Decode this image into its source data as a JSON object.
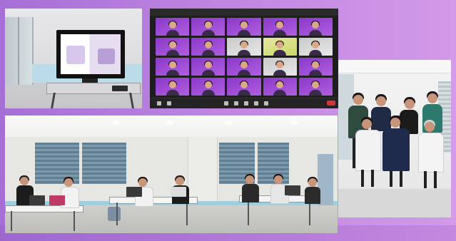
{
  "scene": {
    "photos": [
      {
        "id": "meeting-room-tv"
      },
      {
        "id": "video-call-gallery",
        "grid": {
          "rows": 4,
          "columns": 5
        }
      },
      {
        "id": "group-photo"
      },
      {
        "id": "classroom-session"
      }
    ]
  },
  "colors": {
    "background": "#b07ad8",
    "tile_purple": "#8a39c9",
    "end_button": "#d93232"
  }
}
